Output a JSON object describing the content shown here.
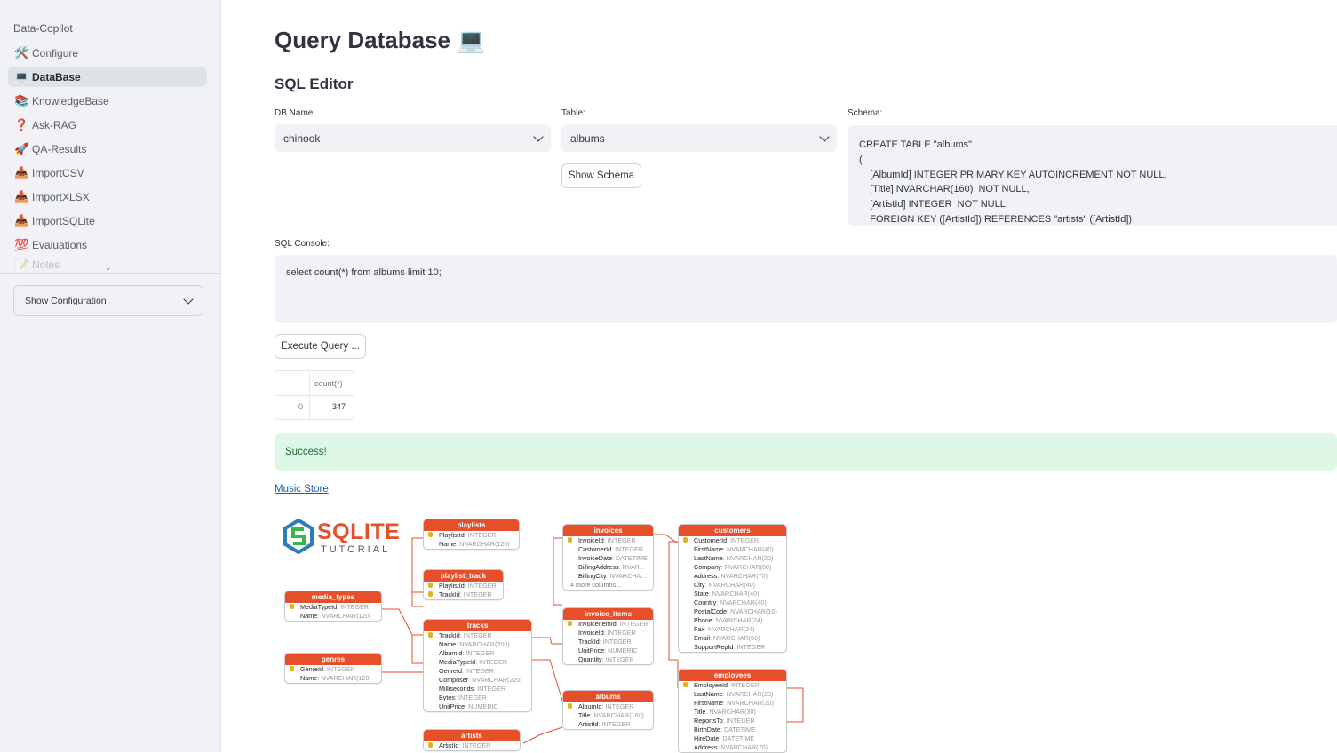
{
  "sidebar": {
    "app_name": "Data-Copilot",
    "items": [
      {
        "icon": "🛠️",
        "icon_name": "tools-icon",
        "label": "Configure"
      },
      {
        "icon": "💻",
        "icon_name": "laptop-icon",
        "label": "DataBase"
      },
      {
        "icon": "📚",
        "icon_name": "books-icon",
        "label": "KnowledgeBase"
      },
      {
        "icon": "❓",
        "icon_name": "question-icon",
        "label": "Ask-RAG"
      },
      {
        "icon": "🚀",
        "icon_name": "rocket-icon",
        "label": "QA-Results"
      },
      {
        "icon": "📥",
        "icon_name": "inbox-tray-icon",
        "label": "ImportCSV"
      },
      {
        "icon": "📥",
        "icon_name": "inbox-tray-icon",
        "label": "ImportXLSX"
      },
      {
        "icon": "📥",
        "icon_name": "inbox-tray-icon",
        "label": "ImportSQLite"
      },
      {
        "icon": "💯",
        "icon_name": "hundred-points-icon",
        "label": "Evaluations"
      },
      {
        "icon": "📝",
        "icon_name": "memo-icon",
        "label": "Notes"
      }
    ],
    "active_item": "DataBase",
    "expander_label": "Show Configuration"
  },
  "main": {
    "title": "Query Database 💻",
    "section": "SQL Editor",
    "db_label": "DB Name",
    "db_value": "chinook",
    "table_label": "Table:",
    "table_value": "albums",
    "show_schema_button": "Show Schema",
    "schema_label": "Schema:",
    "schema_lines": [
      "CREATE TABLE \"albums\"",
      "(",
      "    [AlbumId] INTEGER PRIMARY KEY AUTOINCREMENT NOT NULL,",
      "    [Title] NVARCHAR(160)  NOT NULL,",
      "    [ArtistId] INTEGER  NOT NULL,",
      "    FOREIGN KEY ([ArtistId]) REFERENCES \"artists\" ([ArtistId])"
    ],
    "console_label": "SQL Console:",
    "console_value": "select count(*) from albums limit 10;",
    "execute_button": "Execute Query ...",
    "result": {
      "columns": [
        "",
        "count(*)"
      ],
      "rows": [
        [
          "0",
          "347"
        ]
      ]
    },
    "status": "Success!",
    "link_text": "Music Store"
  },
  "erd": {
    "logo_main": "SQLITE",
    "logo_sub": "TUTORIAL",
    "colors": {
      "header": "#e5502b",
      "line": "#e5502b",
      "key": "#e4b21a"
    },
    "tables": {
      "playlists": {
        "title": "playlists",
        "rows": [
          [
            "PlaylistId",
            "INTEGER",
            true
          ],
          [
            "Name",
            "NVARCHAR(120)",
            false
          ]
        ]
      },
      "playlist_track": {
        "title": "playlist_track",
        "rows": [
          [
            "PlaylistId",
            "INTEGER",
            true
          ],
          [
            "TrackId",
            "INTEGER",
            true
          ]
        ]
      },
      "media_types": {
        "title": "media_types",
        "rows": [
          [
            "MediaTypeId",
            "INTEGER",
            true
          ],
          [
            "Name",
            "NVARCHAR(120)",
            false
          ]
        ]
      },
      "genres": {
        "title": "genres",
        "rows": [
          [
            "GenreId",
            "INTEGER",
            true
          ],
          [
            "Name",
            "NVARCHAR(120)",
            false
          ]
        ]
      },
      "tracks": {
        "title": "tracks",
        "rows": [
          [
            "TrackId",
            "INTEGER",
            true
          ],
          [
            "Name",
            "NVARCHAR(200)",
            false
          ],
          [
            "AlbumId",
            "INTEGER",
            false
          ],
          [
            "MediaTypeId",
            "INTEGER",
            false
          ],
          [
            "GenreId",
            "INTEGER",
            false
          ],
          [
            "Composer",
            "NVARCHAR(220)",
            false
          ],
          [
            "Milliseconds",
            "INTEGER",
            false
          ],
          [
            "Bytes",
            "INTEGER",
            false
          ],
          [
            "UnitPrice",
            "NUMERIC",
            false
          ]
        ]
      },
      "artists": {
        "title": "artists",
        "rows": [
          [
            "ArtistId",
            "INTEGER",
            true
          ]
        ]
      },
      "invoices": {
        "title": "invoices",
        "rows": [
          [
            "InvoiceId",
            "INTEGER",
            true
          ],
          [
            "CustomerId",
            "INTEGER",
            false
          ],
          [
            "InvoiceDate",
            "DATETIME",
            false
          ],
          [
            "BillingAddress",
            "NVAR...",
            false
          ],
          [
            "BillingCity",
            "NVARCHA...",
            false
          ]
        ],
        "more": "4 more columns..."
      },
      "invoice_items": {
        "title": "invoice_items",
        "rows": [
          [
            "InvoiceItemId",
            "INTEGER",
            true
          ],
          [
            "InvoiceId",
            "INTEGER",
            false
          ],
          [
            "TrackId",
            "INTEGER",
            false
          ],
          [
            "UnitPrice",
            "NUMERIC",
            false
          ],
          [
            "Quantity",
            "INTEGER",
            false
          ]
        ]
      },
      "albums": {
        "title": "albums",
        "rows": [
          [
            "AlbumId",
            "INTEGER",
            true
          ],
          [
            "Title",
            "NVARCHAR(160)",
            false
          ],
          [
            "ArtistId",
            "INTEGER",
            false
          ]
        ]
      },
      "customers": {
        "title": "customers",
        "rows": [
          [
            "CustomerId",
            "INTEGER",
            true
          ],
          [
            "FirstName",
            "NVARCHAR(40)",
            false
          ],
          [
            "LastName",
            "NVARCHAR(20)",
            false
          ],
          [
            "Company",
            "NVARCHAR(80)",
            false
          ],
          [
            "Address",
            "NVARCHAR(70)",
            false
          ],
          [
            "City",
            "NVARCHAR(40)",
            false
          ],
          [
            "State",
            "NVARCHAR(40)",
            false
          ],
          [
            "Country",
            "NVARCHAR(40)",
            false
          ],
          [
            "PostalCode",
            "NVARCHAR(10)",
            false
          ],
          [
            "Phone",
            "NVARCHAR(24)",
            false
          ],
          [
            "Fax",
            "NVARCHAR(24)",
            false
          ],
          [
            "Email",
            "NVARCHAR(60)",
            false
          ],
          [
            "SupportRepId",
            "INTEGER",
            false
          ]
        ]
      },
      "employees": {
        "title": "employees",
        "rows": [
          [
            "EmployeeId",
            "INTEGER",
            true
          ],
          [
            "LastName",
            "NVARCHAR(20)",
            false
          ],
          [
            "FirstName",
            "NVARCHAR(20)",
            false
          ],
          [
            "Title",
            "NVARCHAR(30)",
            false
          ],
          [
            "ReportsTo",
            "INTEGER",
            false
          ],
          [
            "BirthDate",
            "DATETIME",
            false
          ],
          [
            "HireDate",
            "DATETIME",
            false
          ],
          [
            "Address",
            "NVARCHAR(70)",
            false
          ]
        ]
      }
    }
  }
}
